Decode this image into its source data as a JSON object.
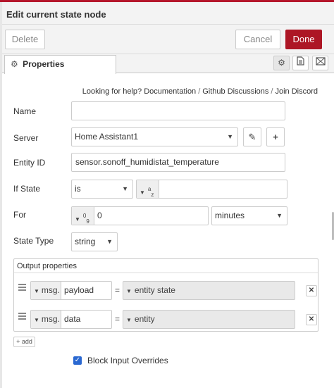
{
  "title": "Edit current state node",
  "actions": {
    "delete": "Delete",
    "cancel": "Cancel",
    "done": "Done"
  },
  "tabs": {
    "properties": "Properties"
  },
  "help": {
    "prefix": "Looking for help?",
    "links": [
      "Documentation",
      "Github Discussions",
      "Join Discord"
    ]
  },
  "form": {
    "name": {
      "label": "Name",
      "value": ""
    },
    "server": {
      "label": "Server",
      "value": "Home Assistant1"
    },
    "entity_id": {
      "label": "Entity ID",
      "value": "sensor.sonoff_humidistat_temperature"
    },
    "if_state": {
      "label": "If State",
      "operator": "is",
      "type_sup": "a",
      "type_sub": "z",
      "value": ""
    },
    "for": {
      "label": "For",
      "type_sup": "0",
      "type_sub": "9",
      "value": "0",
      "units": "minutes"
    },
    "state_type": {
      "label": "State Type",
      "value": "string"
    },
    "output": {
      "label": "Output properties",
      "rows": [
        {
          "prefix": "msg.",
          "property": "payload",
          "eq": "=",
          "value": "entity state"
        },
        {
          "prefix": "msg.",
          "property": "data",
          "eq": "=",
          "value": "entity"
        }
      ],
      "add_label": "add"
    },
    "block_input_overrides": {
      "label": "Block Input Overrides",
      "checked": true
    }
  },
  "colors": {
    "done": "#ad1625",
    "accent": "#b5162b",
    "checkbox": "#2a68d1"
  },
  "icons": [
    "gear-icon",
    "description-icon",
    "appearance-icon",
    "pencil-icon",
    "plus-icon",
    "drag-handle-icon",
    "close-icon",
    "caret-down-icon",
    "check-icon"
  ]
}
